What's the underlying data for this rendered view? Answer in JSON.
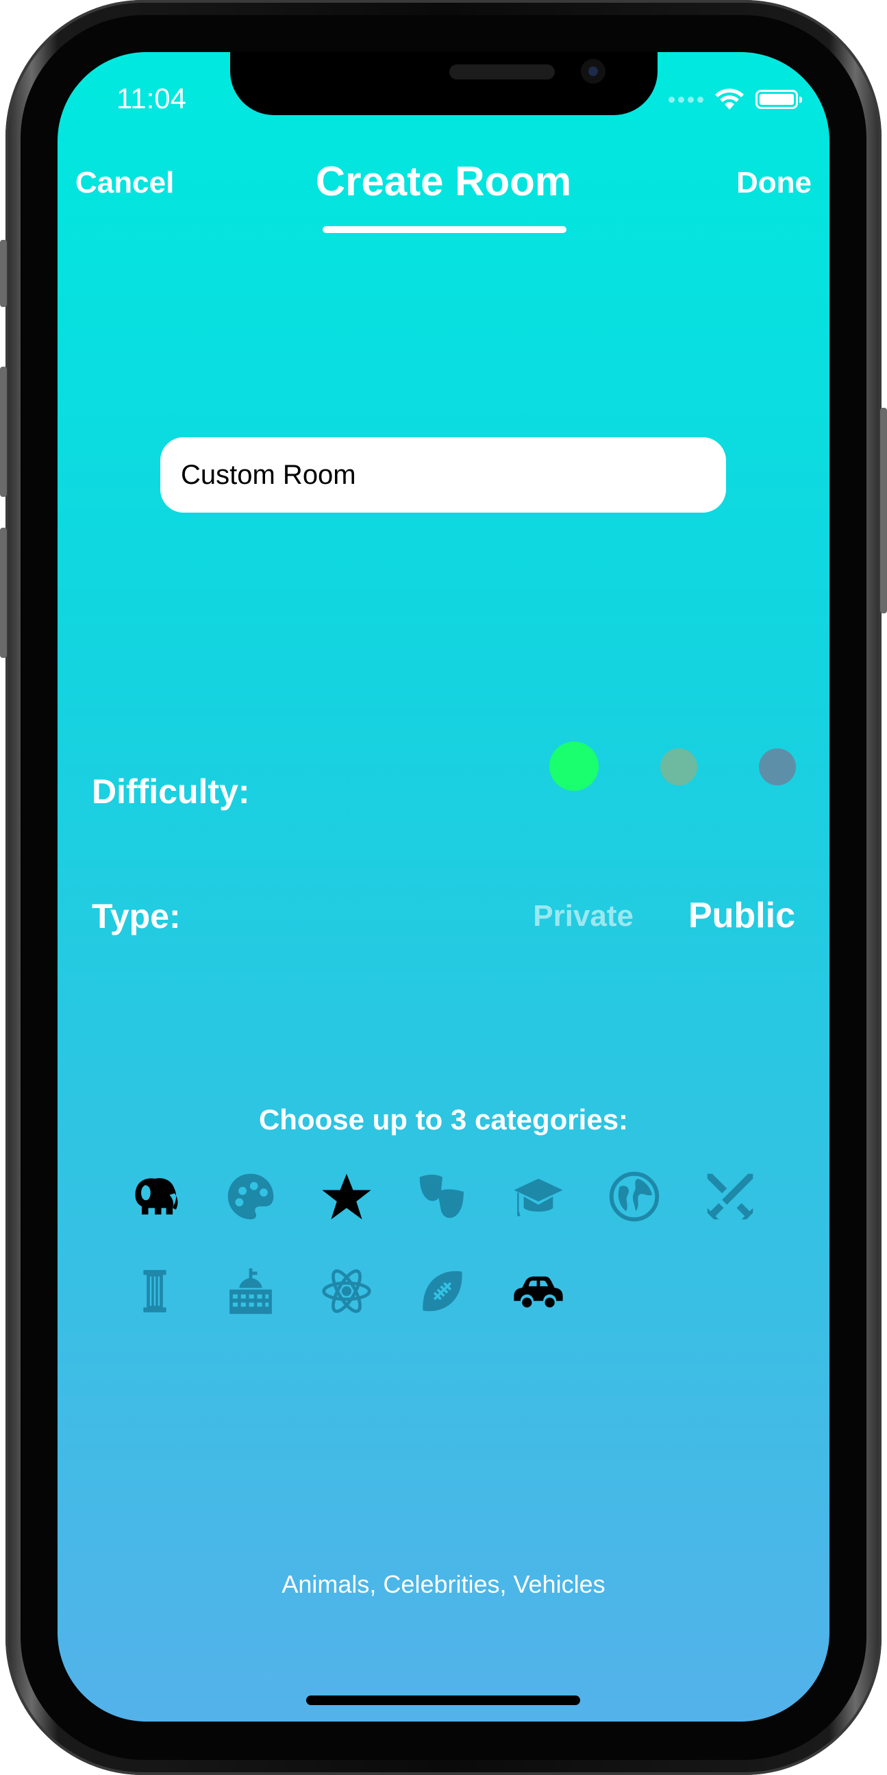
{
  "status_bar": {
    "time": "11:04"
  },
  "nav": {
    "cancel_label": "Cancel",
    "title": "Create Room",
    "done_label": "Done"
  },
  "room_name": {
    "value": "Custom Room"
  },
  "difficulty": {
    "label": "Difficulty:",
    "levels": [
      {
        "color": "#19ff6e",
        "selected": true
      },
      {
        "color": "#6dbaa0",
        "selected": false
      },
      {
        "color": "#5e8fa8",
        "selected": false
      }
    ]
  },
  "type": {
    "label": "Type:",
    "options": [
      {
        "label": "Private",
        "selected": false
      },
      {
        "label": "Public",
        "selected": true
      }
    ]
  },
  "categories": {
    "heading": "Choose up to 3 categories:",
    "items": [
      {
        "icon": "elephant-icon",
        "selected": true
      },
      {
        "icon": "palette-icon",
        "selected": false
      },
      {
        "icon": "star-icon",
        "selected": true
      },
      {
        "icon": "theater-masks-icon",
        "selected": false
      },
      {
        "icon": "graduation-cap-icon",
        "selected": false
      },
      {
        "icon": "globe-icon",
        "selected": false
      },
      {
        "icon": "crossed-swords-icon",
        "selected": false
      },
      {
        "icon": "column-icon",
        "selected": false
      },
      {
        "icon": "government-building-icon",
        "selected": false
      },
      {
        "icon": "atom-icon",
        "selected": false
      },
      {
        "icon": "football-icon",
        "selected": false
      },
      {
        "icon": "car-icon",
        "selected": true
      }
    ],
    "selected_text": "Animals, Celebrities, Vehicles"
  },
  "colors": {
    "selected_icon": "#000000",
    "unselected_icon": "#1b7fa0"
  }
}
